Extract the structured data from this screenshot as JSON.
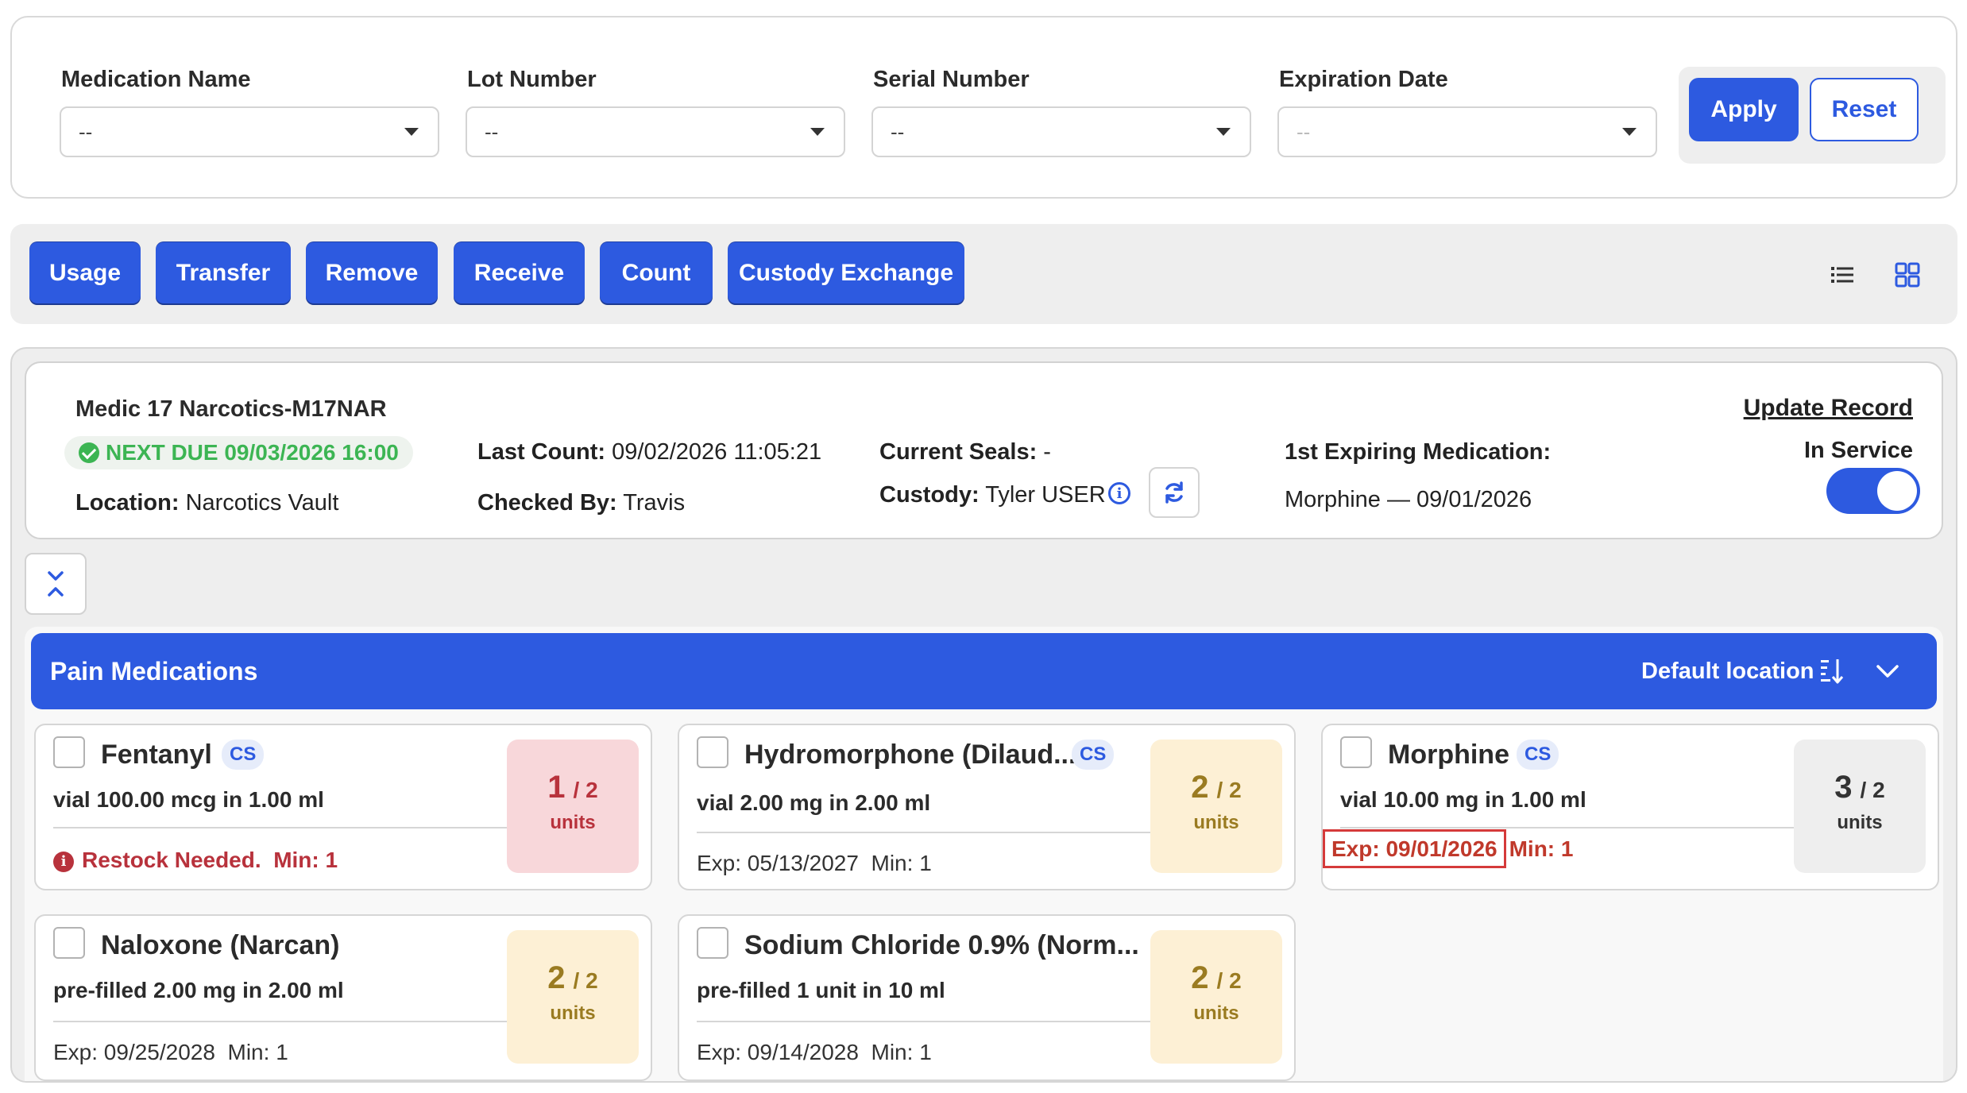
{
  "filters": {
    "fields": [
      {
        "label": "Medication Name",
        "value": "--"
      },
      {
        "label": "Lot Number",
        "value": "--"
      },
      {
        "label": "Serial Number",
        "value": "--"
      },
      {
        "label": "Expiration Date",
        "value": "--"
      }
    ],
    "apply_label": "Apply",
    "reset_label": "Reset"
  },
  "actions": {
    "usage": "Usage",
    "transfer": "Transfer",
    "remove": "Remove",
    "receive": "Receive",
    "count": "Count",
    "custody_exchange": "Custody Exchange",
    "list_view_icon": "list-icon",
    "grid_view_icon": "grid-icon"
  },
  "unit": {
    "title": "Medic 17 Narcotics-M17NAR",
    "next_due": "NEXT DUE 09/03/2026 16:00",
    "location_label": "Location:",
    "location": "Narcotics Vault",
    "last_count_label": "Last Count:",
    "last_count": "09/02/2026 11:05:21",
    "checked_by_label": "Checked By:",
    "checked_by": "Travis",
    "current_seals_label": "Current Seals:",
    "current_seals": "-",
    "custody_label": "Custody:",
    "custody": "Tyler USER",
    "first_expiring_label": "1st Expiring Medication:",
    "first_expiring": "Morphine — 09/01/2026",
    "update_record": "Update Record",
    "in_service_label": "In Service",
    "in_service": true
  },
  "section": {
    "title": "Pain Medications",
    "location_label": "Default location"
  },
  "medications": [
    {
      "name": "Fentanyl",
      "cs": "CS",
      "desc": "vial 100.00 mcg in 1.00 ml",
      "status": "Restock Needed.",
      "min": "Min: 1",
      "qty": "1",
      "max": "/ 2",
      "unit": "units"
    },
    {
      "name": "Hydromorphone (Dilaud...",
      "cs": "CS",
      "desc": "vial 2.00 mg in 2.00 ml",
      "exp": "Exp: 05/13/2027",
      "min": "Min: 1",
      "qty": "2",
      "max": "/ 2",
      "unit": "units"
    },
    {
      "name": "Morphine",
      "cs": "CS",
      "desc": "vial 10.00 mg in 1.00 ml",
      "exp": "Exp: 09/01/2026",
      "min": "Min: 1",
      "qty": "3",
      "max": "/ 2",
      "unit": "units"
    },
    {
      "name": "Naloxone (Narcan)",
      "desc": "pre-filled 2.00 mg in 2.00 ml",
      "exp": "Exp: 09/25/2028",
      "min": "Min: 1",
      "qty": "2",
      "max": "/ 2",
      "unit": "units"
    },
    {
      "name": "Sodium Chloride 0.9% (Norm...",
      "desc": "pre-filled 1 unit in 10 ml",
      "exp": "Exp: 09/14/2028",
      "min": "Min: 1",
      "qty": "2",
      "max": "/ 2",
      "unit": "units"
    }
  ],
  "colors": {
    "primary": "#2d5ae0",
    "success": "#3cb553",
    "danger": "#b8323c",
    "warning_bg": "#fdf0d5",
    "danger_bg": "#f8d7da"
  }
}
